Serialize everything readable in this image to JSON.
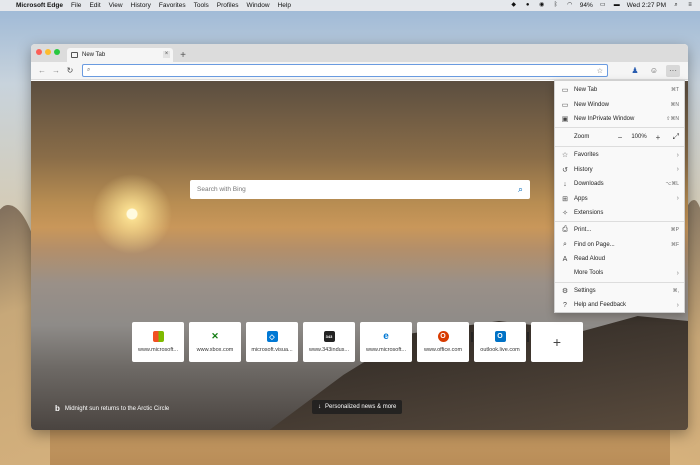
{
  "menubar": {
    "app_name": "Microsoft Edge",
    "items": [
      "File",
      "Edit",
      "View",
      "History",
      "Favorites",
      "Tools",
      "Profiles",
      "Window",
      "Help"
    ],
    "battery": "94%",
    "clock": "Wed 2:27 PM"
  },
  "window": {
    "tab_title": "New Tab",
    "address_value": ""
  },
  "newtab": {
    "search_placeholder": "Search with Bing",
    "image_caption": "Midnight sun returns to the Arctic Circle",
    "personalized_label": "Personalized news & more",
    "tiles": [
      {
        "label": "www.microsoft...",
        "icon": "microsoft-logo-icon",
        "color": "#f25022"
      },
      {
        "label": "www.xbox.com",
        "icon": "xbox-icon",
        "color": "#107c10"
      },
      {
        "label": "microsoft.visua...",
        "icon": "visual-studio-icon",
        "color": "#0078d4"
      },
      {
        "label": "www.343indus...",
        "icon": "343-industries-icon",
        "color": "#222222",
        "text": "343"
      },
      {
        "label": "www.microsoft...",
        "icon": "edge-icon",
        "color": "#0078d4"
      },
      {
        "label": "www.office.com",
        "icon": "office-icon",
        "color": "#d83b01"
      },
      {
        "label": "outlook.live.com",
        "icon": "outlook-icon",
        "color": "#0072c6"
      }
    ]
  },
  "menu": {
    "items": [
      {
        "label": "New Tab",
        "shortcut": "⌘T",
        "icon": "new-tab-icon"
      },
      {
        "label": "New Window",
        "shortcut": "⌘N",
        "icon": "new-window-icon"
      },
      {
        "label": "New InPrivate Window",
        "shortcut": "⇧⌘N",
        "icon": "inprivate-window-icon"
      }
    ],
    "zoom_label": "Zoom",
    "zoom_value": "100%",
    "items2": [
      {
        "label": "Favorites",
        "icon": "star-icon",
        "arrow": true
      },
      {
        "label": "History",
        "icon": "history-icon",
        "arrow": true
      },
      {
        "label": "Downloads",
        "shortcut": "⌥⌘L",
        "icon": "download-icon"
      },
      {
        "label": "Apps",
        "icon": "apps-icon",
        "arrow": true
      },
      {
        "label": "Extensions",
        "icon": "extensions-icon"
      }
    ],
    "items3": [
      {
        "label": "Print...",
        "shortcut": "⌘P",
        "icon": "print-icon"
      },
      {
        "label": "Find on Page...",
        "shortcut": "⌘F",
        "icon": "find-icon"
      },
      {
        "label": "Read Aloud",
        "icon": "read-aloud-icon"
      },
      {
        "label": "More Tools",
        "icon": "",
        "arrow": true
      }
    ],
    "items4": [
      {
        "label": "Settings",
        "shortcut": "⌘,",
        "icon": "settings-icon"
      },
      {
        "label": "Help and Feedback",
        "icon": "help-icon",
        "arrow": true
      }
    ]
  }
}
